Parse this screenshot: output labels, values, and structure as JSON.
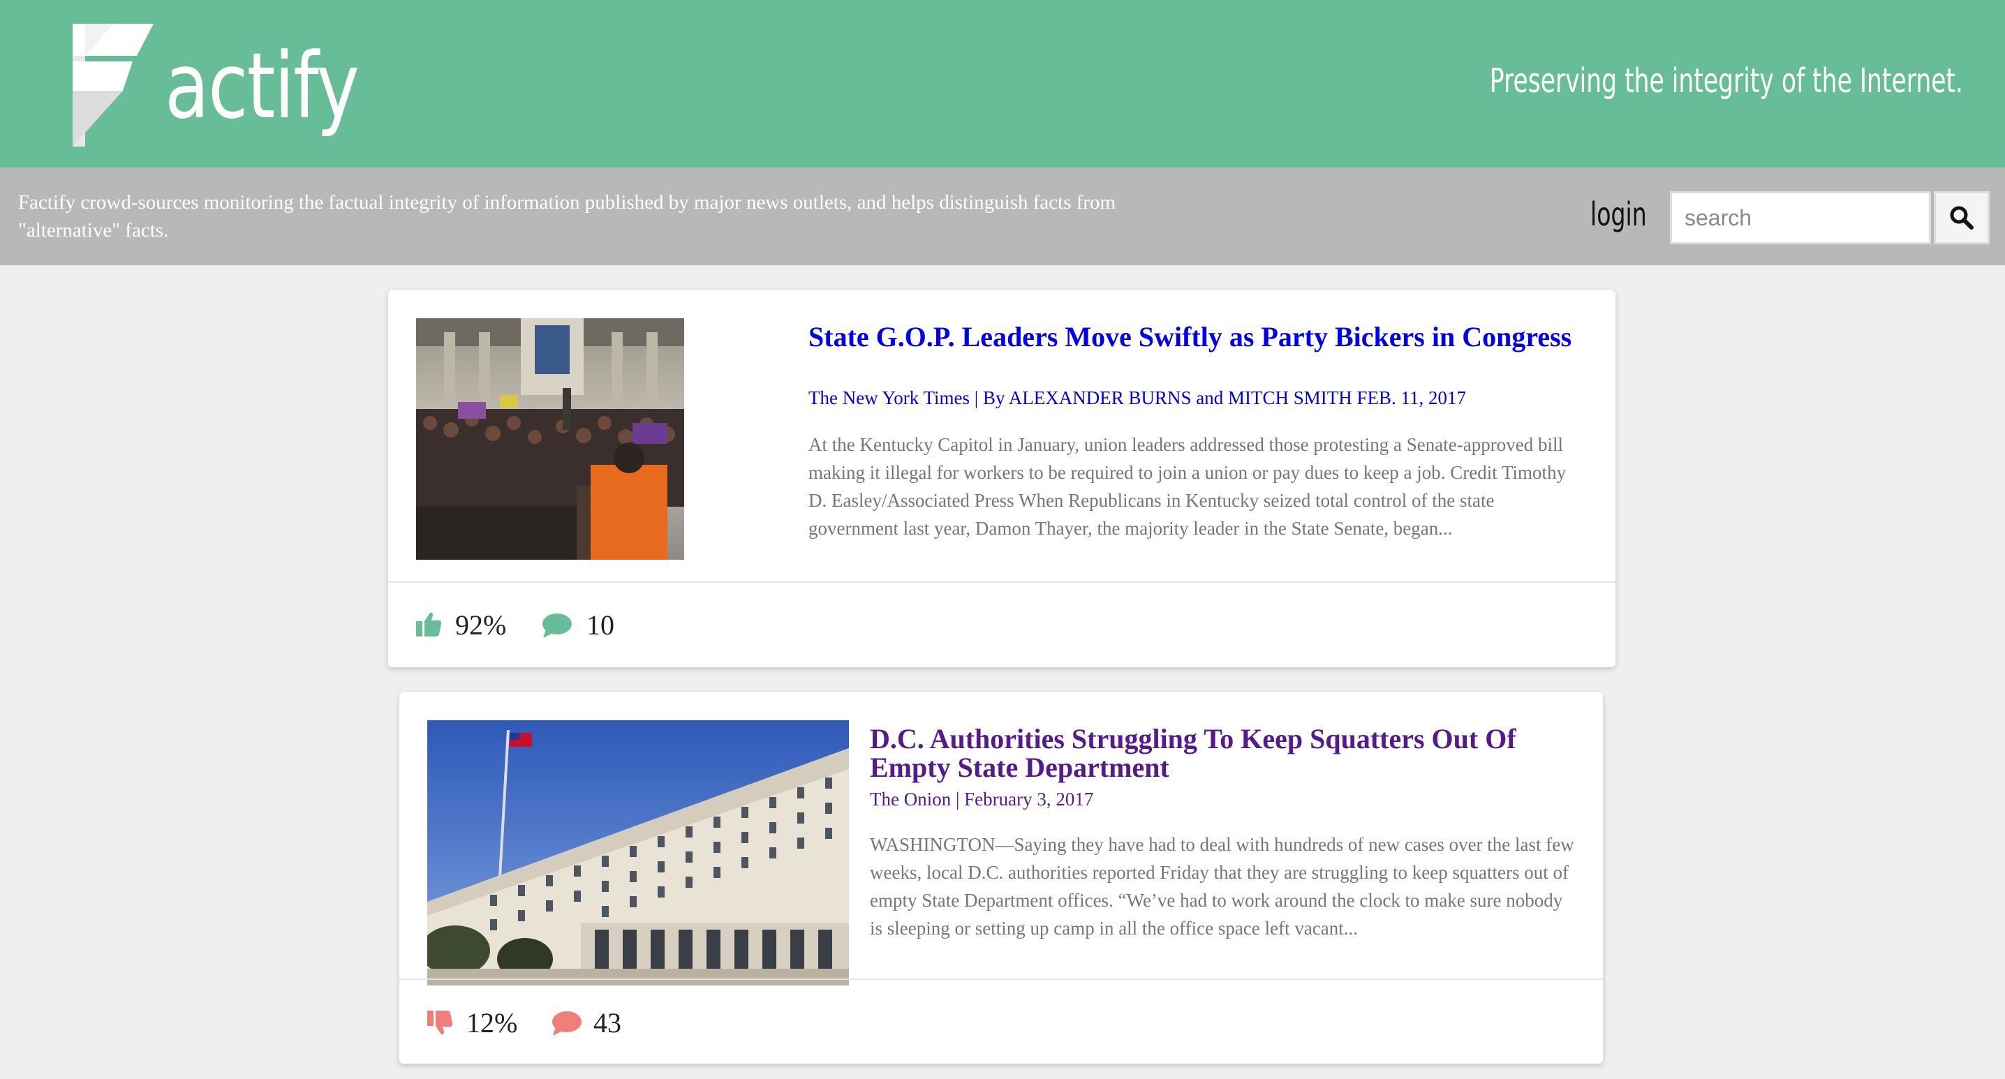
{
  "header": {
    "logo_text": "actify",
    "tagline": "Preserving the integrity of the Internet."
  },
  "subbar": {
    "mission": "Factify crowd-sources monitoring the factual integrity of information published by major news outlets, and helps distinguish facts from \"alternative\" facts.",
    "login_label": "login",
    "search_placeholder": "search"
  },
  "colors": {
    "header_bg": "#67bd98",
    "subbar_bg": "#b8b8b8",
    "positive": "#67bd98",
    "negative": "#f07f7c",
    "link": "#0000ee",
    "visited": "#551a8b"
  },
  "articles": [
    {
      "title": "State G.O.P. Leaders Move Swiftly as Party Bickers in Congress",
      "meta": "The New York Times | By ALEXANDER BURNS and MITCH SMITH FEB. 11, 2017",
      "snippet": "At the Kentucky Capitol in January, union leaders addressed those protesting a Senate-approved bill making it illegal for workers to be required to join a union or pay dues to keep a job. Credit Timothy D. Easley/Associated Press When Republicans in Kentucky seized total control of the state government last year, Damon Thayer, the majority leader in the State Senate, began...",
      "rating": "92%",
      "rating_icon": "thumbs-up-icon",
      "comments": "10",
      "comment_icon": "comment-icon"
    },
    {
      "title": "D.C. Authorities Struggling To Keep Squatters Out Of Empty State Department",
      "meta": "The Onion | February 3, 2017",
      "snippet": "WASHINGTON—Saying they have had to deal with hundreds of new cases over the last few weeks, local D.C. authorities reported Friday that they are struggling to keep squatters out of empty State Department offices. “We’ve had to work around the clock to make sure nobody is sleeping or setting up camp in all the office space left vacant...",
      "rating": "12%",
      "rating_icon": "thumbs-down-icon",
      "comments": "43",
      "comment_icon": "comment-icon"
    }
  ]
}
